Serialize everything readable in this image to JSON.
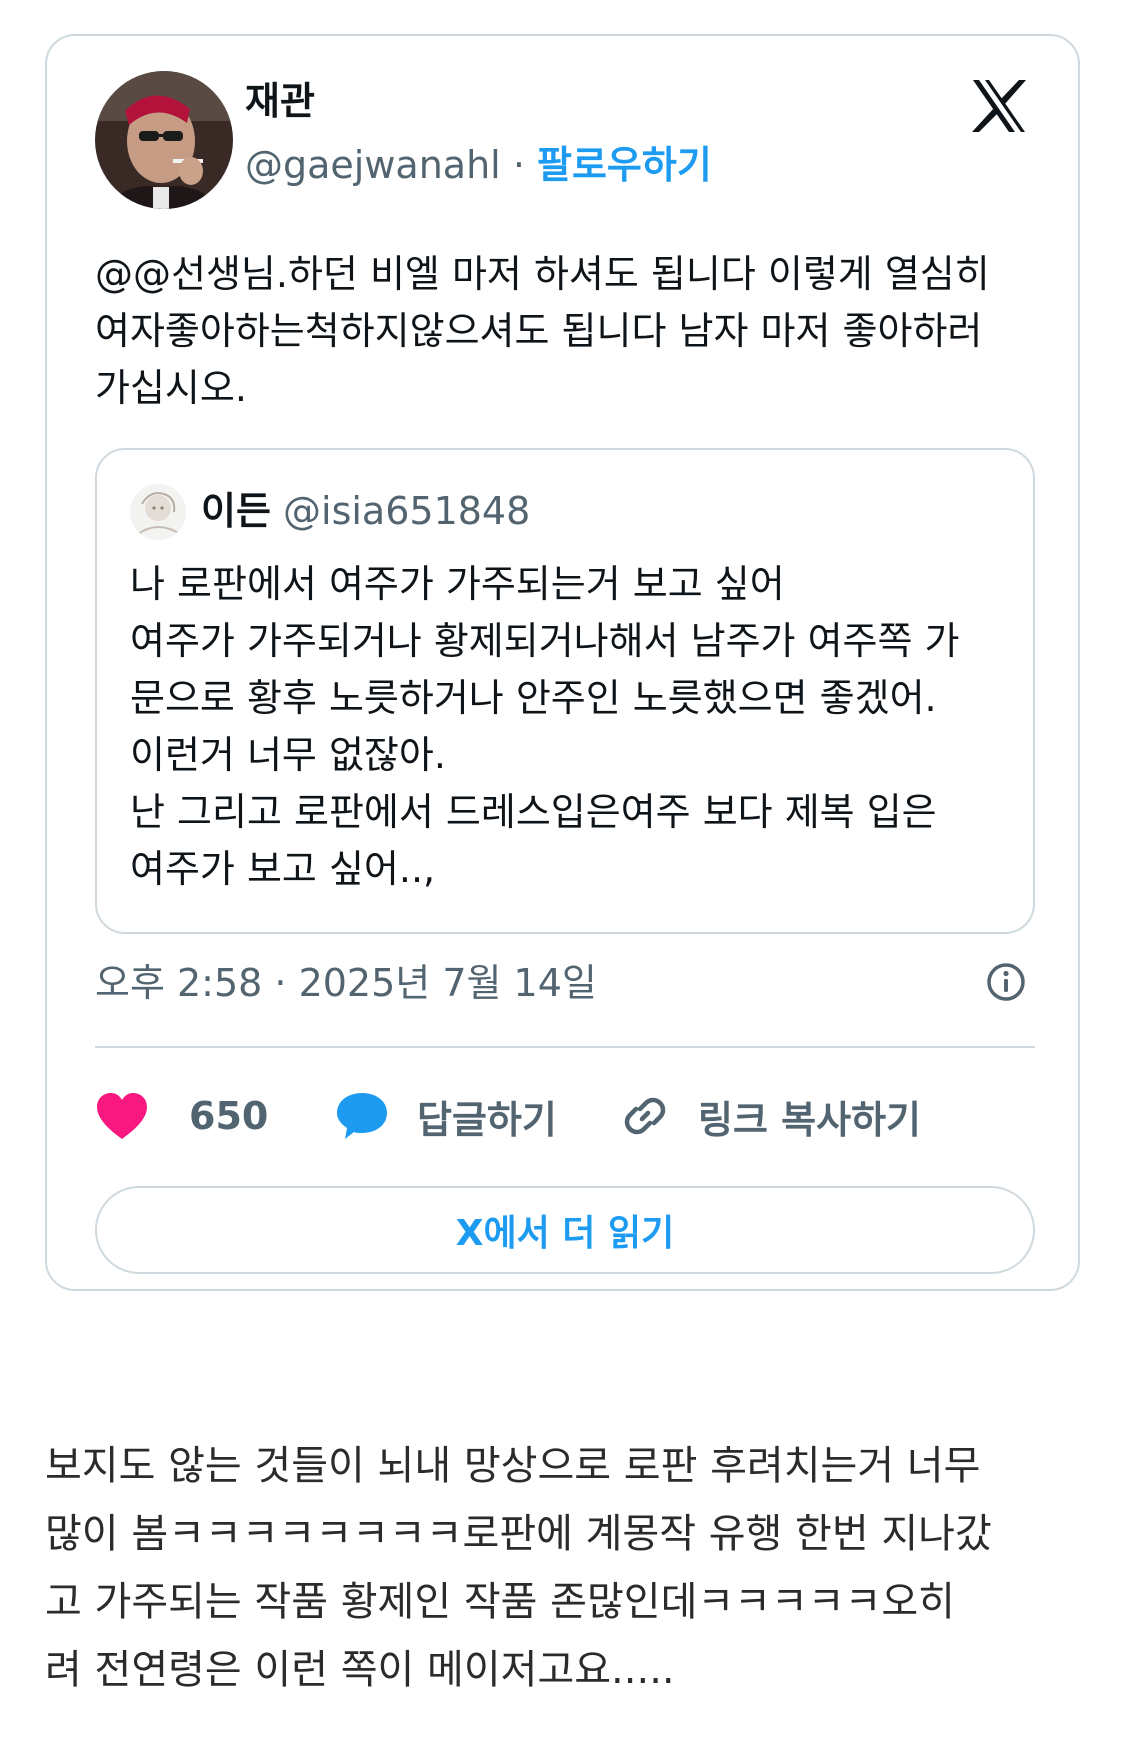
{
  "tweet": {
    "author_name": "재관",
    "handle": "@gaejwanahl",
    "separator": "·",
    "follow_label": "팔로우하기",
    "text": "@@선생님.하던 비엘 마저 하셔도 됩니다 이렇게 열심히\n여자좋아하는척하지않으셔도 됩니다 남자 마저 좋아하러\n가십시오.",
    "quote": {
      "author_name": "이든",
      "handle": "@isia651848",
      "text": "나 로판에서 여주가 가주되는거 보고 싶어\n여주가 가주되거나 황제되거나해서 남주가 여주쪽 가\n문으로 황후 노릇하거나 안주인 노릇했으면 좋겠어.\n이런거 너무 없잖아.\n난 그리고 로판에서 드레스입은여주 보다 제복 입은\n여주가 보고 싶어..,"
    },
    "timestamp": "오후 2:58 · 2025년 7월 14일",
    "like_count": "650",
    "reply_label": "답글하기",
    "copy_link_label": "링크 복사하기",
    "read_more_label": "X에서 더 읽기"
  },
  "body_text": "보지도 않는 것들이 뇌내 망상으로 로판 후려치는거 너무\n많이 봄ㅋㅋㅋㅋㅋㅋㅋㅋ로판에 계몽작 유행 한번 지나갔\n고 가주되는 작품 황제인 작품 존많인데ㅋㅋㅋㅋㅋ오히\n려 전연령은 이런 쪽이 메이저고요.....",
  "icons": {
    "avatar": "avatar-photo",
    "logo": "x-logo-icon",
    "info": "info-icon",
    "like": "heart-icon",
    "reply": "speech-bubble-icon",
    "copy": "link-icon"
  },
  "colors": {
    "accent": "#1d9bf0",
    "like": "#f91880",
    "muted": "#536471",
    "border": "#cfd9de"
  }
}
